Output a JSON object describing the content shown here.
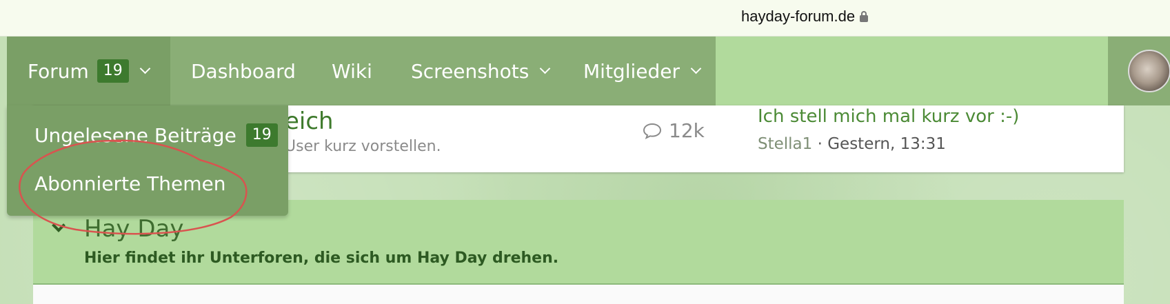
{
  "browser": {
    "url": "hayday-forum.de",
    "cut_top_text": "~~ ~ ~ ~~ ~~~ ~~~"
  },
  "nav": {
    "forum_label": "Forum",
    "forum_badge": "19",
    "dashboard_label": "Dashboard",
    "wiki_label": "Wiki",
    "screenshots_label": "Screenshots",
    "members_label": "Mitglieder"
  },
  "dropdown": {
    "unread_label": "Ungelesene Beiträge",
    "unread_badge": "19",
    "subscribed_label": "Abonnierte Themen"
  },
  "forum_row": {
    "title_fragment": "eich",
    "description_fragment": "User kurz vorstellen.",
    "post_count": "12k",
    "last_post_title": "Ich stell mich mal kurz vor :-)",
    "last_post_author": "Stella1",
    "last_post_separator": " · ",
    "last_post_time": "Gestern, 13:31"
  },
  "category": {
    "title": "Hay Day",
    "description": "Hier findet ihr Unterforen, die sich um Hay Day drehen."
  },
  "colors": {
    "nav_bg": "#8aae76",
    "nav_active_bg": "#7a9f66",
    "badge_bg": "#3d7a2e",
    "link_green": "#4b8a35",
    "annotation_red": "#d9534f"
  }
}
